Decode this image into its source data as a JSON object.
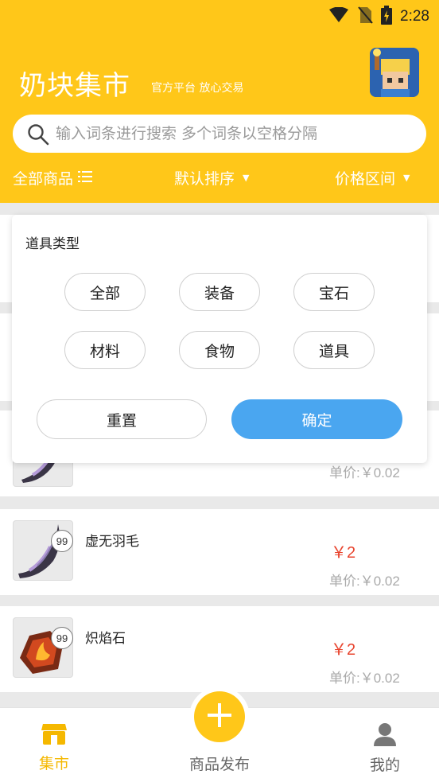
{
  "status": {
    "time": "2:28"
  },
  "header": {
    "title": "奶块集市",
    "subtitle": "官方平台 放心交易"
  },
  "search": {
    "placeholder": "输入词条进行搜索 多个词条以空格分隔"
  },
  "filters": {
    "all_label": "全部商品",
    "sort_label": "默认排序",
    "price_label": "价格区间"
  },
  "popup": {
    "title": "道具类型",
    "chips": [
      "全部",
      "装备",
      "宝石",
      "材料",
      "食物",
      "道具"
    ],
    "reset_label": "重置",
    "confirm_label": "确定"
  },
  "items": [
    {
      "name": "",
      "qty": "",
      "price": "",
      "unit_price": "单价:￥0.02",
      "icon": "feather-icon"
    },
    {
      "name": "虚无羽毛",
      "qty": "99",
      "price": "￥2",
      "unit_price": "单价:￥0.02",
      "icon": "feather-icon"
    },
    {
      "name": "炽焰石",
      "qty": "99",
      "price": "￥2",
      "unit_price": "单价:￥0.02",
      "icon": "fire-stone-icon"
    }
  ],
  "nav": {
    "market_label": "集市",
    "publish_label": "商品发布",
    "mine_label": "我的"
  },
  "colors": {
    "brand": "#ffc719",
    "accent_blue": "#4aa6f0",
    "price_red": "#e8442e"
  }
}
